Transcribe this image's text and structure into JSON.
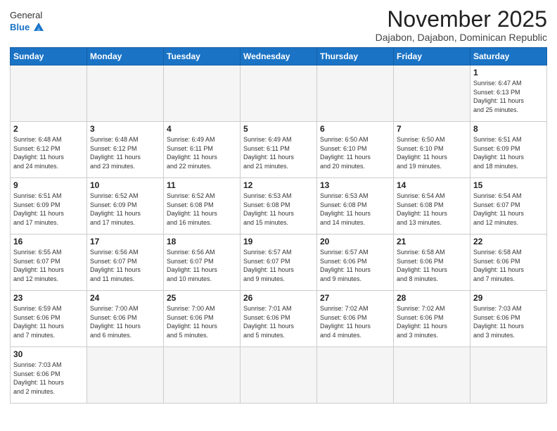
{
  "header": {
    "logo_line1": "General",
    "logo_line2": "Blue",
    "month_title": "November 2025",
    "subtitle": "Dajabon, Dajabon, Dominican Republic"
  },
  "weekdays": [
    "Sunday",
    "Monday",
    "Tuesday",
    "Wednesday",
    "Thursday",
    "Friday",
    "Saturday"
  ],
  "weeks": [
    [
      {
        "day": "",
        "info": ""
      },
      {
        "day": "",
        "info": ""
      },
      {
        "day": "",
        "info": ""
      },
      {
        "day": "",
        "info": ""
      },
      {
        "day": "",
        "info": ""
      },
      {
        "day": "",
        "info": ""
      },
      {
        "day": "1",
        "info": "Sunrise: 6:47 AM\nSunset: 6:13 PM\nDaylight: 11 hours\nand 25 minutes."
      }
    ],
    [
      {
        "day": "2",
        "info": "Sunrise: 6:48 AM\nSunset: 6:12 PM\nDaylight: 11 hours\nand 24 minutes."
      },
      {
        "day": "3",
        "info": "Sunrise: 6:48 AM\nSunset: 6:12 PM\nDaylight: 11 hours\nand 23 minutes."
      },
      {
        "day": "4",
        "info": "Sunrise: 6:49 AM\nSunset: 6:11 PM\nDaylight: 11 hours\nand 22 minutes."
      },
      {
        "day": "5",
        "info": "Sunrise: 6:49 AM\nSunset: 6:11 PM\nDaylight: 11 hours\nand 21 minutes."
      },
      {
        "day": "6",
        "info": "Sunrise: 6:50 AM\nSunset: 6:10 PM\nDaylight: 11 hours\nand 20 minutes."
      },
      {
        "day": "7",
        "info": "Sunrise: 6:50 AM\nSunset: 6:10 PM\nDaylight: 11 hours\nand 19 minutes."
      },
      {
        "day": "8",
        "info": "Sunrise: 6:51 AM\nSunset: 6:09 PM\nDaylight: 11 hours\nand 18 minutes."
      }
    ],
    [
      {
        "day": "9",
        "info": "Sunrise: 6:51 AM\nSunset: 6:09 PM\nDaylight: 11 hours\nand 17 minutes."
      },
      {
        "day": "10",
        "info": "Sunrise: 6:52 AM\nSunset: 6:09 PM\nDaylight: 11 hours\nand 17 minutes."
      },
      {
        "day": "11",
        "info": "Sunrise: 6:52 AM\nSunset: 6:08 PM\nDaylight: 11 hours\nand 16 minutes."
      },
      {
        "day": "12",
        "info": "Sunrise: 6:53 AM\nSunset: 6:08 PM\nDaylight: 11 hours\nand 15 minutes."
      },
      {
        "day": "13",
        "info": "Sunrise: 6:53 AM\nSunset: 6:08 PM\nDaylight: 11 hours\nand 14 minutes."
      },
      {
        "day": "14",
        "info": "Sunrise: 6:54 AM\nSunset: 6:08 PM\nDaylight: 11 hours\nand 13 minutes."
      },
      {
        "day": "15",
        "info": "Sunrise: 6:54 AM\nSunset: 6:07 PM\nDaylight: 11 hours\nand 12 minutes."
      }
    ],
    [
      {
        "day": "16",
        "info": "Sunrise: 6:55 AM\nSunset: 6:07 PM\nDaylight: 11 hours\nand 12 minutes."
      },
      {
        "day": "17",
        "info": "Sunrise: 6:56 AM\nSunset: 6:07 PM\nDaylight: 11 hours\nand 11 minutes."
      },
      {
        "day": "18",
        "info": "Sunrise: 6:56 AM\nSunset: 6:07 PM\nDaylight: 11 hours\nand 10 minutes."
      },
      {
        "day": "19",
        "info": "Sunrise: 6:57 AM\nSunset: 6:07 PM\nDaylight: 11 hours\nand 9 minutes."
      },
      {
        "day": "20",
        "info": "Sunrise: 6:57 AM\nSunset: 6:06 PM\nDaylight: 11 hours\nand 9 minutes."
      },
      {
        "day": "21",
        "info": "Sunrise: 6:58 AM\nSunset: 6:06 PM\nDaylight: 11 hours\nand 8 minutes."
      },
      {
        "day": "22",
        "info": "Sunrise: 6:58 AM\nSunset: 6:06 PM\nDaylight: 11 hours\nand 7 minutes."
      }
    ],
    [
      {
        "day": "23",
        "info": "Sunrise: 6:59 AM\nSunset: 6:06 PM\nDaylight: 11 hours\nand 7 minutes."
      },
      {
        "day": "24",
        "info": "Sunrise: 7:00 AM\nSunset: 6:06 PM\nDaylight: 11 hours\nand 6 minutes."
      },
      {
        "day": "25",
        "info": "Sunrise: 7:00 AM\nSunset: 6:06 PM\nDaylight: 11 hours\nand 5 minutes."
      },
      {
        "day": "26",
        "info": "Sunrise: 7:01 AM\nSunset: 6:06 PM\nDaylight: 11 hours\nand 5 minutes."
      },
      {
        "day": "27",
        "info": "Sunrise: 7:02 AM\nSunset: 6:06 PM\nDaylight: 11 hours\nand 4 minutes."
      },
      {
        "day": "28",
        "info": "Sunrise: 7:02 AM\nSunset: 6:06 PM\nDaylight: 11 hours\nand 3 minutes."
      },
      {
        "day": "29",
        "info": "Sunrise: 7:03 AM\nSunset: 6:06 PM\nDaylight: 11 hours\nand 3 minutes."
      }
    ],
    [
      {
        "day": "30",
        "info": "Sunrise: 7:03 AM\nSunset: 6:06 PM\nDaylight: 11 hours\nand 2 minutes."
      },
      {
        "day": "",
        "info": ""
      },
      {
        "day": "",
        "info": ""
      },
      {
        "day": "",
        "info": ""
      },
      {
        "day": "",
        "info": ""
      },
      {
        "day": "",
        "info": ""
      },
      {
        "day": "",
        "info": ""
      }
    ]
  ]
}
